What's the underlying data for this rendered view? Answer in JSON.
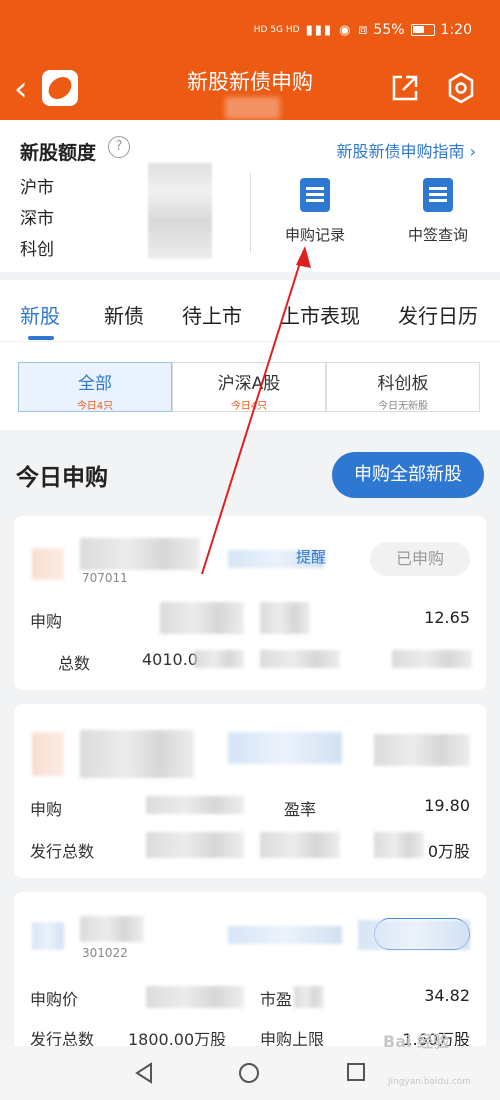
{
  "status_bar": {
    "network": "HD 5G HD",
    "battery_percent": "55%",
    "time": "1:20"
  },
  "header": {
    "title": "新股新债申购",
    "share_icon": "share-icon",
    "settings_icon": "gear-icon"
  },
  "quota": {
    "title": "新股额度",
    "guide_link": "新股新债申购指南 ›",
    "markets": [
      "沪市",
      "深市",
      "科创"
    ],
    "actions": [
      {
        "label": "申购记录",
        "icon": "record-icon"
      },
      {
        "label": "中签查询",
        "icon": "lottery-check-icon"
      }
    ]
  },
  "tabs": [
    "新股",
    "新债",
    "待上市",
    "上市表现",
    "发行日历"
  ],
  "active_tab": "新股",
  "segments": [
    {
      "label": "全部",
      "sub": "今日4只"
    },
    {
      "label": "沪深A股",
      "sub": "今日4只"
    },
    {
      "label": "科创板",
      "sub": "今日无新股"
    }
  ],
  "today": {
    "title": "今日申购",
    "apply_all_button": "申购全部新股",
    "cards": [
      {
        "code": "707011",
        "remind": "提醒",
        "status": "已申购",
        "row1_label": "申购",
        "row1_value": "12.65",
        "row2_label": "总数",
        "row2_value": "4010.0"
      },
      {
        "row1_label": "申购",
        "row1_mid_label": "盈率",
        "row1_value": "19.80",
        "row2_label": "发行总数",
        "row2_value": "0万股"
      },
      {
        "code": "301022",
        "row1_label": "申购价",
        "row1_mid_label": "市盈",
        "row1_value": "34.82",
        "row2_label": "发行总数",
        "row2_value": "1800.00万股",
        "row2_mid_label": "申购上限",
        "row2_right_value": "1.60万股"
      }
    ]
  },
  "watermark": {
    "text": "Bai 经验",
    "url": "jingyan.baidu.com"
  }
}
